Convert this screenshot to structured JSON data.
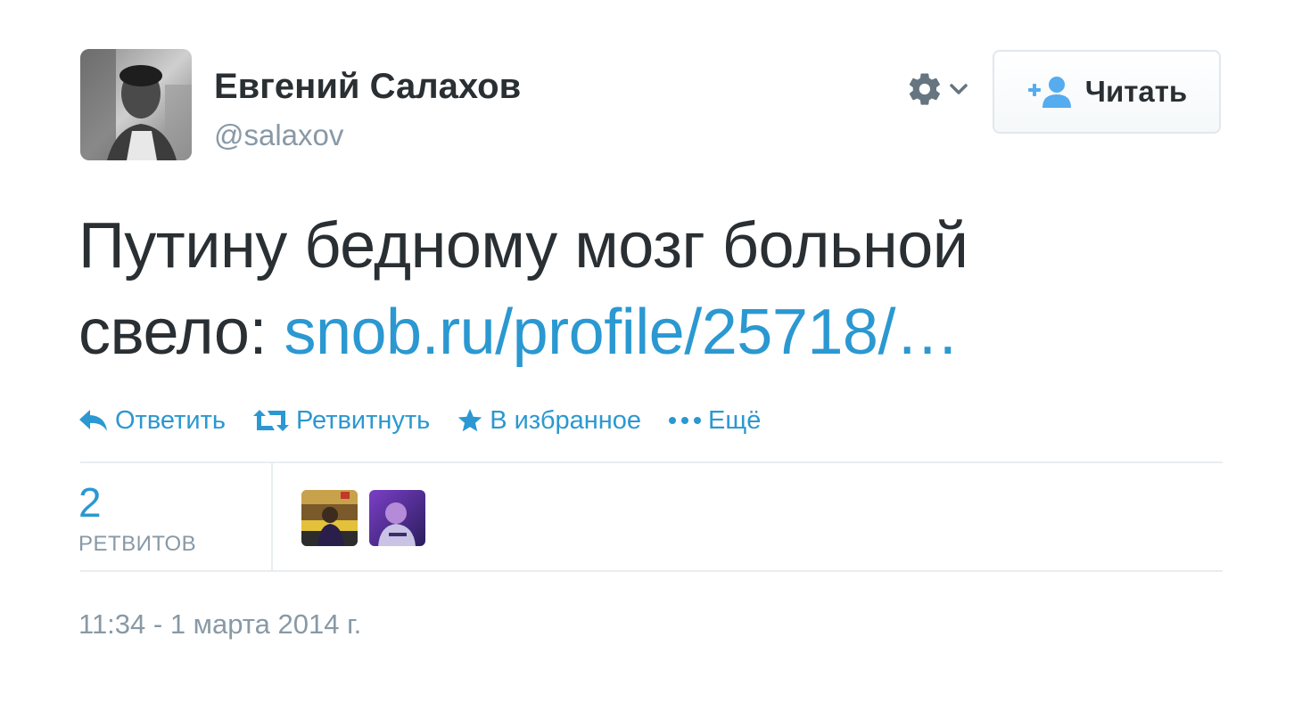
{
  "tweet": {
    "author": {
      "full_name": "Евгений Салахов",
      "username": "@salaxov"
    },
    "follow_button_label": "Читать",
    "text_main": "Путину бедному мозг больной свело: ",
    "text_link": "snob.ru/profile/25718/…",
    "actions": {
      "reply": "Ответить",
      "retweet": "Ретвитнуть",
      "favorite": "В избранное",
      "more": "Ещё"
    },
    "stats": {
      "retweet_count": "2",
      "retweet_label": "РЕТВИТОВ"
    },
    "timestamp": "11:34 - 1 марта 2014 г."
  },
  "icons": {
    "gear": "gear-icon",
    "dropdown": "chevron-down-icon",
    "follow": "add-person-icon",
    "reply": "reply-icon",
    "retweet": "retweet-icon",
    "favorite": "star-icon",
    "more": "ellipsis-icon"
  },
  "colors": {
    "link_blue": "#2b98d1",
    "text_dark": "#292f33",
    "text_gray": "#8899a6",
    "divider": "#e8edf0"
  }
}
